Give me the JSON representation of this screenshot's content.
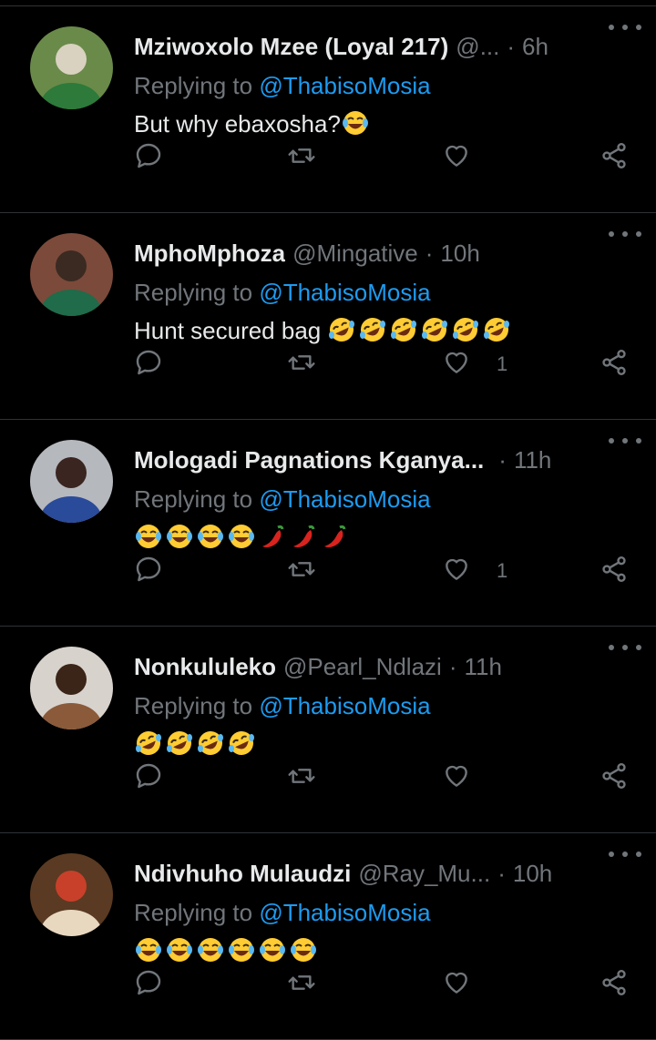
{
  "tweets": [
    {
      "name": "Mziwoxolo Mzee (Loyal 217)",
      "handle": "@...",
      "time": "6h",
      "replying_label": "Replying to",
      "mention": "@ThabisoMosia",
      "text": "But why ebaxosha?",
      "emojis": [
        "tears-of-joy"
      ],
      "likes": "",
      "avatar_colors": [
        "#6a8a4a",
        "#d9d2c0",
        "#2d7a3a"
      ]
    },
    {
      "name": "MphoMphoza",
      "handle": "@Mingative",
      "time": "10h",
      "replying_label": "Replying to",
      "mention": "@ThabisoMosia",
      "text": "Hunt secured bag ",
      "emojis": [
        "rolling-laughing",
        "rolling-laughing",
        "rolling-laughing",
        "rolling-laughing",
        "rolling-laughing",
        "rolling-laughing"
      ],
      "likes": "1",
      "avatar_colors": [
        "#7b4a3a",
        "#3a2a22",
        "#1f6b4a"
      ]
    },
    {
      "name": "Mologadi Pagnations Kganya...",
      "handle": "",
      "time": "11h",
      "replying_label": "Replying to",
      "mention": "@ThabisoMosia",
      "text": "",
      "emojis": [
        "tears-of-joy",
        "tears-of-joy",
        "tears-of-joy",
        "tears-of-joy",
        "chili-pepper",
        "chili-pepper",
        "chili-pepper"
      ],
      "likes": "1",
      "avatar_colors": [
        "#b5b8bd",
        "#3a2520",
        "#2a4a9a"
      ]
    },
    {
      "name": "Nonkululeko",
      "handle": "@Pearl_Ndlazi",
      "time": "11h",
      "replying_label": "Replying to",
      "mention": "@ThabisoMosia",
      "text": "",
      "emojis": [
        "rolling-laughing",
        "rolling-laughing",
        "rolling-laughing",
        "rolling-laughing"
      ],
      "likes": "",
      "avatar_colors": [
        "#d8d2cc",
        "#3b2418",
        "#8a5a3a"
      ]
    },
    {
      "name": "Ndivhuho Mulaudzi",
      "handle": "@Ray_Mu...",
      "time": "10h",
      "replying_label": "Replying to",
      "mention": "@ThabisoMosia",
      "text": "",
      "emojis": [
        "tears-of-joy",
        "tears-of-joy",
        "tears-of-joy",
        "tears-of-joy",
        "tears-of-joy",
        "tears-of-joy"
      ],
      "likes": "",
      "avatar_colors": [
        "#5a3a22",
        "#c8402a",
        "#e8d8c0"
      ]
    }
  ],
  "icons": {
    "reply": "reply-icon",
    "retweet": "retweet-icon",
    "like": "heart-icon",
    "share": "share-icon",
    "more": "more-icon"
  },
  "colors": {
    "background": "#000000",
    "text": "#e7e9ea",
    "muted": "#71767b",
    "link": "#1d9bf0",
    "divider": "#2f3336"
  }
}
